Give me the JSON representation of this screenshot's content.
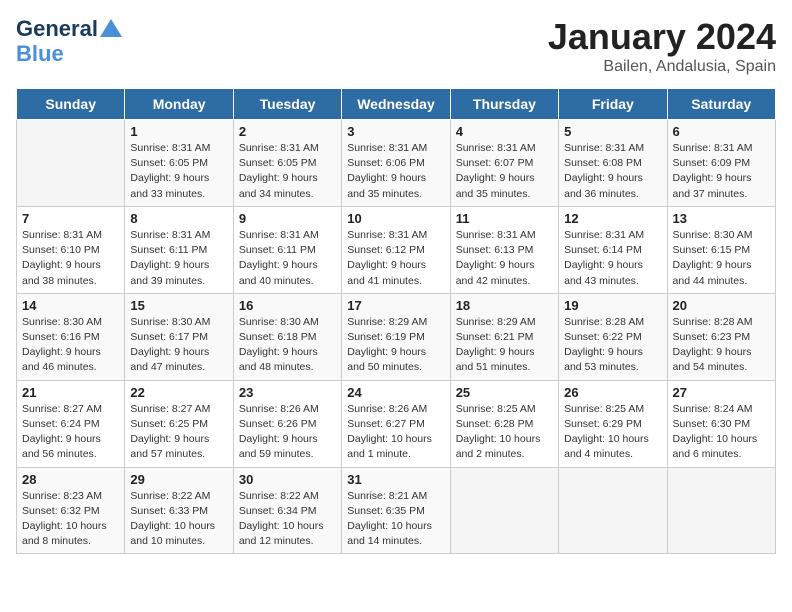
{
  "header": {
    "logo_line1": "General",
    "logo_line2": "Blue",
    "month": "January 2024",
    "location": "Bailen, Andalusia, Spain"
  },
  "weekdays": [
    "Sunday",
    "Monday",
    "Tuesday",
    "Wednesday",
    "Thursday",
    "Friday",
    "Saturday"
  ],
  "weeks": [
    [
      {
        "day": "",
        "sunrise": "",
        "sunset": "",
        "daylight": ""
      },
      {
        "day": "1",
        "sunrise": "Sunrise: 8:31 AM",
        "sunset": "Sunset: 6:05 PM",
        "daylight": "Daylight: 9 hours and 33 minutes."
      },
      {
        "day": "2",
        "sunrise": "Sunrise: 8:31 AM",
        "sunset": "Sunset: 6:05 PM",
        "daylight": "Daylight: 9 hours and 34 minutes."
      },
      {
        "day": "3",
        "sunrise": "Sunrise: 8:31 AM",
        "sunset": "Sunset: 6:06 PM",
        "daylight": "Daylight: 9 hours and 35 minutes."
      },
      {
        "day": "4",
        "sunrise": "Sunrise: 8:31 AM",
        "sunset": "Sunset: 6:07 PM",
        "daylight": "Daylight: 9 hours and 35 minutes."
      },
      {
        "day": "5",
        "sunrise": "Sunrise: 8:31 AM",
        "sunset": "Sunset: 6:08 PM",
        "daylight": "Daylight: 9 hours and 36 minutes."
      },
      {
        "day": "6",
        "sunrise": "Sunrise: 8:31 AM",
        "sunset": "Sunset: 6:09 PM",
        "daylight": "Daylight: 9 hours and 37 minutes."
      }
    ],
    [
      {
        "day": "7",
        "sunrise": "Sunrise: 8:31 AM",
        "sunset": "Sunset: 6:10 PM",
        "daylight": "Daylight: 9 hours and 38 minutes."
      },
      {
        "day": "8",
        "sunrise": "Sunrise: 8:31 AM",
        "sunset": "Sunset: 6:11 PM",
        "daylight": "Daylight: 9 hours and 39 minutes."
      },
      {
        "day": "9",
        "sunrise": "Sunrise: 8:31 AM",
        "sunset": "Sunset: 6:11 PM",
        "daylight": "Daylight: 9 hours and 40 minutes."
      },
      {
        "day": "10",
        "sunrise": "Sunrise: 8:31 AM",
        "sunset": "Sunset: 6:12 PM",
        "daylight": "Daylight: 9 hours and 41 minutes."
      },
      {
        "day": "11",
        "sunrise": "Sunrise: 8:31 AM",
        "sunset": "Sunset: 6:13 PM",
        "daylight": "Daylight: 9 hours and 42 minutes."
      },
      {
        "day": "12",
        "sunrise": "Sunrise: 8:31 AM",
        "sunset": "Sunset: 6:14 PM",
        "daylight": "Daylight: 9 hours and 43 minutes."
      },
      {
        "day": "13",
        "sunrise": "Sunrise: 8:30 AM",
        "sunset": "Sunset: 6:15 PM",
        "daylight": "Daylight: 9 hours and 44 minutes."
      }
    ],
    [
      {
        "day": "14",
        "sunrise": "Sunrise: 8:30 AM",
        "sunset": "Sunset: 6:16 PM",
        "daylight": "Daylight: 9 hours and 46 minutes."
      },
      {
        "day": "15",
        "sunrise": "Sunrise: 8:30 AM",
        "sunset": "Sunset: 6:17 PM",
        "daylight": "Daylight: 9 hours and 47 minutes."
      },
      {
        "day": "16",
        "sunrise": "Sunrise: 8:30 AM",
        "sunset": "Sunset: 6:18 PM",
        "daylight": "Daylight: 9 hours and 48 minutes."
      },
      {
        "day": "17",
        "sunrise": "Sunrise: 8:29 AM",
        "sunset": "Sunset: 6:19 PM",
        "daylight": "Daylight: 9 hours and 50 minutes."
      },
      {
        "day": "18",
        "sunrise": "Sunrise: 8:29 AM",
        "sunset": "Sunset: 6:21 PM",
        "daylight": "Daylight: 9 hours and 51 minutes."
      },
      {
        "day": "19",
        "sunrise": "Sunrise: 8:28 AM",
        "sunset": "Sunset: 6:22 PM",
        "daylight": "Daylight: 9 hours and 53 minutes."
      },
      {
        "day": "20",
        "sunrise": "Sunrise: 8:28 AM",
        "sunset": "Sunset: 6:23 PM",
        "daylight": "Daylight: 9 hours and 54 minutes."
      }
    ],
    [
      {
        "day": "21",
        "sunrise": "Sunrise: 8:27 AM",
        "sunset": "Sunset: 6:24 PM",
        "daylight": "Daylight: 9 hours and 56 minutes."
      },
      {
        "day": "22",
        "sunrise": "Sunrise: 8:27 AM",
        "sunset": "Sunset: 6:25 PM",
        "daylight": "Daylight: 9 hours and 57 minutes."
      },
      {
        "day": "23",
        "sunrise": "Sunrise: 8:26 AM",
        "sunset": "Sunset: 6:26 PM",
        "daylight": "Daylight: 9 hours and 59 minutes."
      },
      {
        "day": "24",
        "sunrise": "Sunrise: 8:26 AM",
        "sunset": "Sunset: 6:27 PM",
        "daylight": "Daylight: 10 hours and 1 minute."
      },
      {
        "day": "25",
        "sunrise": "Sunrise: 8:25 AM",
        "sunset": "Sunset: 6:28 PM",
        "daylight": "Daylight: 10 hours and 2 minutes."
      },
      {
        "day": "26",
        "sunrise": "Sunrise: 8:25 AM",
        "sunset": "Sunset: 6:29 PM",
        "daylight": "Daylight: 10 hours and 4 minutes."
      },
      {
        "day": "27",
        "sunrise": "Sunrise: 8:24 AM",
        "sunset": "Sunset: 6:30 PM",
        "daylight": "Daylight: 10 hours and 6 minutes."
      }
    ],
    [
      {
        "day": "28",
        "sunrise": "Sunrise: 8:23 AM",
        "sunset": "Sunset: 6:32 PM",
        "daylight": "Daylight: 10 hours and 8 minutes."
      },
      {
        "day": "29",
        "sunrise": "Sunrise: 8:22 AM",
        "sunset": "Sunset: 6:33 PM",
        "daylight": "Daylight: 10 hours and 10 minutes."
      },
      {
        "day": "30",
        "sunrise": "Sunrise: 8:22 AM",
        "sunset": "Sunset: 6:34 PM",
        "daylight": "Daylight: 10 hours and 12 minutes."
      },
      {
        "day": "31",
        "sunrise": "Sunrise: 8:21 AM",
        "sunset": "Sunset: 6:35 PM",
        "daylight": "Daylight: 10 hours and 14 minutes."
      },
      {
        "day": "",
        "sunrise": "",
        "sunset": "",
        "daylight": ""
      },
      {
        "day": "",
        "sunrise": "",
        "sunset": "",
        "daylight": ""
      },
      {
        "day": "",
        "sunrise": "",
        "sunset": "",
        "daylight": ""
      }
    ]
  ]
}
